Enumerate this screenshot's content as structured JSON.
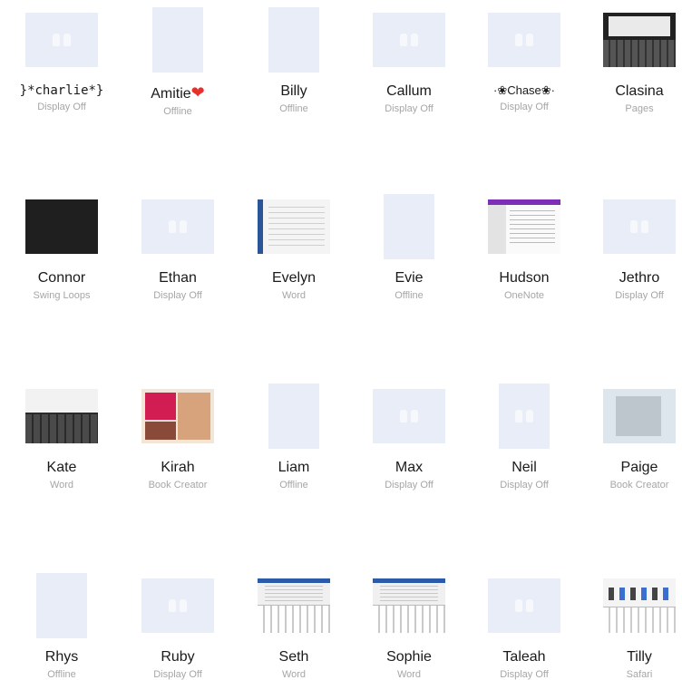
{
  "students": [
    {
      "name": "}*charlie*}",
      "status": "Display Off"
    },
    {
      "name": "Amitie",
      "status": "Offline",
      "emoji": "❤"
    },
    {
      "name": "Billy",
      "status": "Offline"
    },
    {
      "name": "Callum",
      "status": "Display Off"
    },
    {
      "name": "·❀Chase❀·",
      "status": "Display Off"
    },
    {
      "name": "Clasina",
      "status": "Pages"
    },
    {
      "name": "Connor",
      "status": "Swing Loops"
    },
    {
      "name": "Ethan",
      "status": "Display Off"
    },
    {
      "name": "Evelyn",
      "status": "Word"
    },
    {
      "name": "Evie",
      "status": "Offline"
    },
    {
      "name": "Hudson",
      "status": "OneNote"
    },
    {
      "name": "Jethro",
      "status": "Display Off"
    },
    {
      "name": "Kate",
      "status": "Word"
    },
    {
      "name": "Kirah",
      "status": "Book Creator"
    },
    {
      "name": "Liam",
      "status": "Offline"
    },
    {
      "name": "Max",
      "status": "Display Off"
    },
    {
      "name": "Neil",
      "status": "Display Off"
    },
    {
      "name": "Paige",
      "status": "Book Creator"
    },
    {
      "name": "Rhys",
      "status": "Offline"
    },
    {
      "name": "Ruby",
      "status": "Display Off"
    },
    {
      "name": "Seth",
      "status": "Word"
    },
    {
      "name": "Sophie",
      "status": "Word"
    },
    {
      "name": "Taleah",
      "status": "Display Off"
    },
    {
      "name": "Tilly",
      "status": "Safari"
    }
  ],
  "colors": {
    "placeholder": "#e8edf8",
    "name_text": "#1a1a1a",
    "status_text": "#a6a6a6",
    "heart": "#e8302a"
  }
}
